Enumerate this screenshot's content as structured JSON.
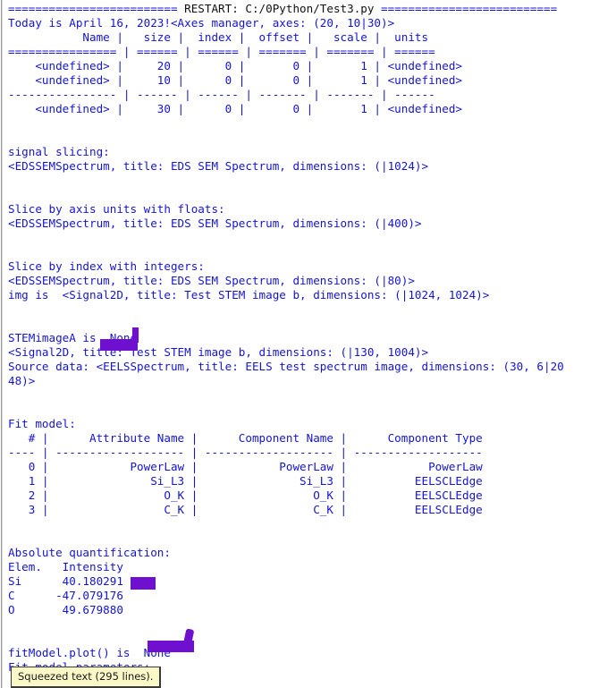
{
  "window": {
    "kind": "python-idle-shell",
    "text_color": "#1414d4",
    "restart_keyword_color": "#101010",
    "background": "#ffffff",
    "annotation_color": "#6f0fd0"
  },
  "console": {
    "lines": [
      "========================= RESTART: C:/0Python/Test3.py ==========================",
      "Today is April 16, 2023!<Axes manager, axes: (20, 10|30)>",
      "           Name |   size |  index |  offset |   scale |  units",
      "================ | ====== | ====== | ======= | ======= | ======",
      "    <undefined> |     20 |      0 |       0 |       1 | <undefined>",
      "    <undefined> |     10 |      0 |       0 |       1 | <undefined>",
      "---------------- | ------ | ------ | ------- | ------- | ------",
      "    <undefined> |     30 |      0 |       0 |       1 | <undefined>",
      "",
      "",
      "signal slicing:",
      "<EDSSEMSpectrum, title: EDS SEM Spectrum, dimensions: (|1024)>",
      "",
      "",
      "Slice by axis units with floats:",
      "<EDSSEMSpectrum, title: EDS SEM Spectrum, dimensions: (|400)>",
      "",
      "",
      "Slice by index with integers:",
      "<EDSSEMSpectrum, title: EDS SEM Spectrum, dimensions: (|80)>",
      "img is  <Signal2D, title: Test STEM image b, dimensions: (|1024, 1024)>",
      "",
      "",
      "STEMimageA is  None",
      "<Signal2D, title: Test STEM image b, dimensions: (|130, 1004)>",
      "Source data: <EELSSpectrum, title: EELS test spectrum image, dimensions: (30, 6|20",
      "48)>",
      "",
      "",
      "Fit model:",
      "   # |      Attribute Name |      Component Name |      Component Type",
      "---- | ------------------- | ------------------- | -------------------",
      "   0 |            PowerLaw |            PowerLaw |            PowerLaw",
      "   1 |               Si_L3 |               Si_L3 |          EELSCLEdge",
      "   2 |                 O_K |                 O_K |          EELSCLEdge",
      "   3 |                 C_K |                 C_K |          EELSCLEdge",
      "",
      "",
      "Absolute quantification:",
      "Elem.   Intensity",
      "Si      40.180291",
      "C      -47.079176",
      "O       49.679880",
      "",
      "",
      "fitModel.plot() is  None",
      "Fit model parameters:"
    ],
    "restart_line": {
      "prefix_equals": "=========================",
      "keyword": " RESTART: C:/0Python/Test3.py ",
      "suffix_equals": "=========================="
    }
  },
  "axes_manager": {
    "summary": "<Axes manager, axes: (20, 10|30)>",
    "greeting": "Today is April 16, 2023!",
    "headers": [
      "Name",
      "size",
      "index",
      "offset",
      "scale",
      "units"
    ],
    "rows": [
      {
        "name": "<undefined>",
        "size": "20",
        "index": "0",
        "offset": "0",
        "scale": "1",
        "units": "<undefined>"
      },
      {
        "name": "<undefined>",
        "size": "10",
        "index": "0",
        "offset": "0",
        "scale": "1",
        "units": "<undefined>"
      },
      {
        "name": "<undefined>",
        "size": "30",
        "index": "0",
        "offset": "0",
        "scale": "1",
        "units": "<undefined>"
      }
    ]
  },
  "fit_model": {
    "title": "Fit model:",
    "headers": [
      "#",
      "Attribute Name",
      "Component Name",
      "Component Type"
    ],
    "rows": [
      {
        "index": "0",
        "attribute": "PowerLaw",
        "component": "PowerLaw",
        "type": "PowerLaw"
      },
      {
        "index": "1",
        "attribute": "Si_L3",
        "component": "Si_L3",
        "type": "EELSCLEdge"
      },
      {
        "index": "2",
        "attribute": "O_K",
        "component": "O_K",
        "type": "EELSCLEdge"
      },
      {
        "index": "3",
        "attribute": "C_K",
        "component": "C_K",
        "type": "EELSCLEdge"
      }
    ]
  },
  "quantification": {
    "title": "Absolute quantification:",
    "headers": [
      "Elem.",
      "Intensity"
    ],
    "rows": [
      {
        "element": "Si",
        "intensity": "40.180291"
      },
      {
        "element": "C",
        "intensity": "-47.079176"
      },
      {
        "element": "O",
        "intensity": "49.679880"
      }
    ]
  },
  "squeezed": {
    "label": "Squeezed text (295 lines)."
  }
}
